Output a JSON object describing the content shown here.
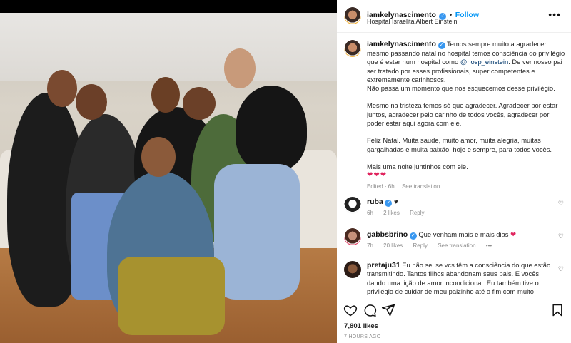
{
  "post": {
    "author": "iamkelynascimento",
    "follow_label": "Follow",
    "location": "Hospital Israelita Albert Einstein",
    "more_label": "•••"
  },
  "caption": {
    "author": "iamkelynascimento",
    "p1_before": "Temos sempre muito a agradecer, mesmo passando natal no hospital temos consciência do privilégio que é estar num hospital como ",
    "p1_mention": "@hosp_einstein",
    "p1_after": ". De ver nosso pai ser tratado por esses profissionais, super competentes e extremamente carinhosos.",
    "p1b": "Não passa um momento que nos esquecemos desse privilégio.",
    "p2": "Mesmo na tristeza temos só que agradecer. Agradecer por estar juntos, agradecer pelo carinho de todos vocês, agradecer por poder estar aqui agora com ele.",
    "p3": "Feliz Natal. Muita saude, muito amor, muita alegria, muitas gargalhadas e muita paixão, hoje e sempre, para todos vocês.",
    "p4": "Mais uma noite juntinhos com ele.",
    "hearts": "❤❤❤",
    "edited": "Edited · 6h",
    "see_translation": "See translation"
  },
  "comments": [
    {
      "user": "ruba",
      "text": "♥",
      "time": "6h",
      "likes": "2 likes",
      "reply": "Reply",
      "verified": true
    },
    {
      "user": "gabbsbrino",
      "text": "Que venham mais e mais dias",
      "time": "7h",
      "likes": "20 likes",
      "reply": "Reply",
      "see_translation": "See translation",
      "more": "•••",
      "verified": true
    },
    {
      "user": "pretaju31",
      "text": "Eu não sei se vcs têm a consciência do que estão transmitindo. Tantos filhos abandonam seus pais. E vocês dando uma lição de amor incondicional. Eu também tive o privilégio de cuidar de meu paizinho até o fim com muito"
    }
  ],
  "footer": {
    "likes": "7,801 likes",
    "time_ago": "7 HOURS AGO"
  },
  "colors": {
    "accent": "#0095f6",
    "heart": "#e0245e",
    "verified": "#3897f0"
  }
}
